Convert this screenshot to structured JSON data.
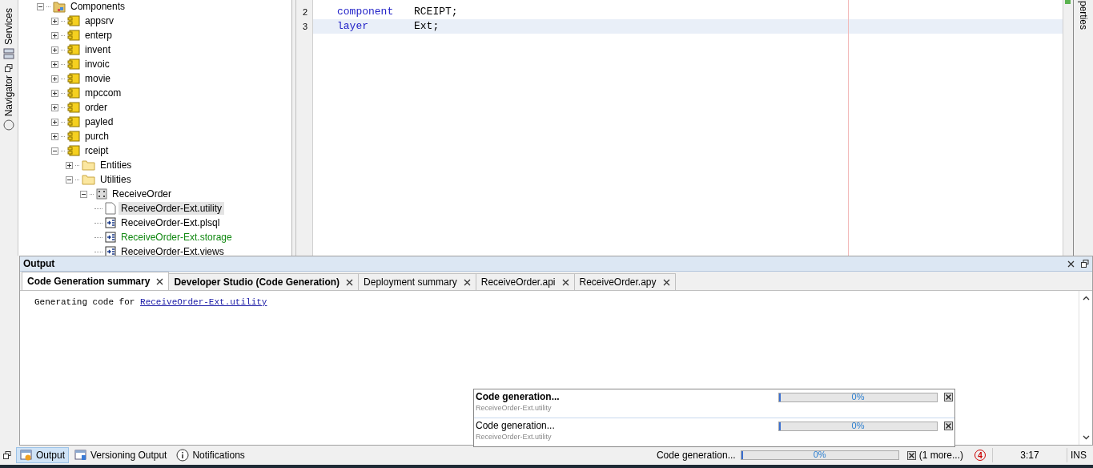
{
  "left_strip": [
    {
      "label": "Services",
      "kind": "services"
    },
    {
      "label": "Navigator",
      "kind": "navigator"
    }
  ],
  "tree": {
    "label": "Components",
    "expanded": true,
    "kind": "components",
    "children": [
      {
        "label": "appsrv",
        "kind": "module",
        "expanded": false
      },
      {
        "label": "enterp",
        "kind": "module",
        "expanded": false
      },
      {
        "label": "invent",
        "kind": "module",
        "expanded": false
      },
      {
        "label": "invoic",
        "kind": "module",
        "expanded": false
      },
      {
        "label": "movie",
        "kind": "module",
        "expanded": false
      },
      {
        "label": "mpccom",
        "kind": "module",
        "expanded": false
      },
      {
        "label": "order",
        "kind": "module",
        "expanded": false
      },
      {
        "label": "payled",
        "kind": "module",
        "expanded": false
      },
      {
        "label": "purch",
        "kind": "module",
        "expanded": false
      },
      {
        "label": "rceipt",
        "kind": "module",
        "expanded": true,
        "children": [
          {
            "label": "Entities",
            "kind": "folder",
            "expanded": false
          },
          {
            "label": "Utilities",
            "kind": "folder",
            "expanded": true,
            "children": [
              {
                "label": "ReceiveOrder",
                "kind": "utility",
                "expanded": true,
                "children": [
                  {
                    "label": "ReceiveOrder-Ext.utility",
                    "kind": "file",
                    "selected": true,
                    "modified": false
                  },
                  {
                    "label": "ReceiveOrder-Ext.plsql",
                    "kind": "source",
                    "selected": false,
                    "modified": false
                  },
                  {
                    "label": "ReceiveOrder-Ext.storage",
                    "kind": "source",
                    "selected": false,
                    "modified": true
                  },
                  {
                    "label": "ReceiveOrder-Ext.views",
                    "kind": "source",
                    "selected": false,
                    "modified": false
                  }
                ]
              }
            ]
          }
        ]
      }
    ]
  },
  "editor": {
    "lines": [
      {
        "number": "2",
        "keyword": "component",
        "value": "RCEIPT;",
        "current": false
      },
      {
        "number": "3",
        "keyword": "layer",
        "value": "Ext;",
        "current": true
      }
    ]
  },
  "right_strip": {
    "label": "perties"
  },
  "output": {
    "title": "Output",
    "tabs": [
      {
        "label": "Code Generation summary",
        "selected": true,
        "bold": true
      },
      {
        "label": "Developer Studio (Code Generation)",
        "selected": false,
        "bold": true
      },
      {
        "label": "Deployment summary",
        "selected": false,
        "bold": false
      },
      {
        "label": "ReceiveOrder.api",
        "selected": false,
        "bold": false
      },
      {
        "label": "ReceiveOrder.apy",
        "selected": false,
        "bold": false
      }
    ],
    "text": "Generating code for",
    "link": "ReceiveOrder-Ext.utility"
  },
  "progress_tasks": [
    {
      "title": "Code generation...",
      "subtitle": "ReceiveOrder-Ext.utility",
      "percent": "0%",
      "level": 0,
      "bold": true
    },
    {
      "title": "Code generation...",
      "subtitle": "ReceiveOrder-Ext.utility",
      "percent": "0%",
      "level": 0,
      "bold": false
    }
  ],
  "status_bar": {
    "windows": [
      {
        "label": "Output",
        "kind": "output",
        "selected": true
      },
      {
        "label": "Versioning Output",
        "kind": "versioning",
        "selected": false
      },
      {
        "label": "Notifications",
        "kind": "notifications",
        "selected": false
      }
    ],
    "task": "Code generation...",
    "percent": "0%",
    "level": 0,
    "more": "(1 more...)",
    "notifications": "4",
    "position": "3:17",
    "mode": "INS"
  }
}
